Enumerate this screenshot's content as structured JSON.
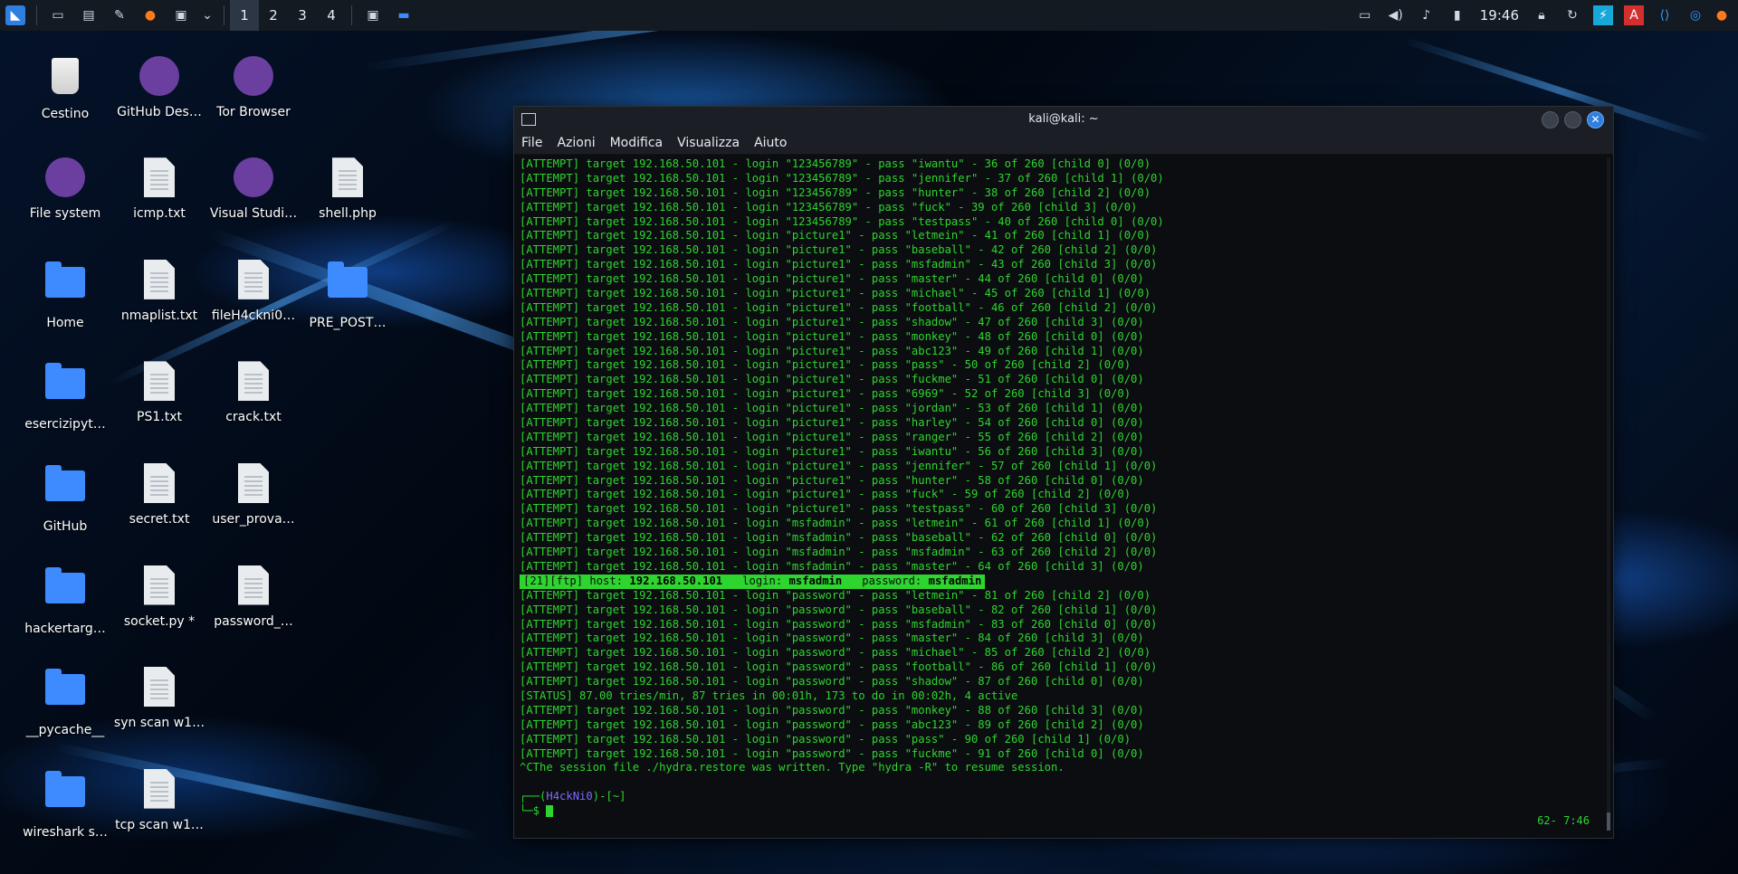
{
  "panel": {
    "workspaces": [
      "1",
      "2",
      "3",
      "4"
    ],
    "clock": "19:46"
  },
  "desktop": {
    "icons": [
      {
        "label": "Cestino",
        "kind": "bin"
      },
      {
        "label": "GitHub Des…",
        "kind": "app"
      },
      {
        "label": "Tor Browser",
        "kind": "app"
      },
      {
        "label": "File system",
        "kind": "app"
      },
      {
        "label": "icmp.txt",
        "kind": "doc"
      },
      {
        "label": "Visual Studi…",
        "kind": "app"
      },
      {
        "label": "shell.php",
        "kind": "doc"
      },
      {
        "label": "Home",
        "kind": "folder"
      },
      {
        "label": "nmaplist.txt",
        "kind": "doc"
      },
      {
        "label": "fileH4ckni0…",
        "kind": "doc"
      },
      {
        "label": "PRE_POST…",
        "kind": "folder"
      },
      {
        "label": "esercizipyt…",
        "kind": "folder"
      },
      {
        "label": "PS1.txt",
        "kind": "doc"
      },
      {
        "label": "crack.txt",
        "kind": "doc"
      },
      {
        "label": "GitHub",
        "kind": "folder"
      },
      {
        "label": "secret.txt",
        "kind": "doc"
      },
      {
        "label": "user_prova…",
        "kind": "doc"
      },
      {
        "label": "hackertarg…",
        "kind": "folder"
      },
      {
        "label": "socket.py *",
        "kind": "doc"
      },
      {
        "label": "password_…",
        "kind": "doc"
      },
      {
        "label": "__pycache__",
        "kind": "folder"
      },
      {
        "label": "syn scan w1…",
        "kind": "doc"
      },
      {
        "label": "wireshark s…",
        "kind": "folder"
      },
      {
        "label": "tcp scan w1…",
        "kind": "doc"
      }
    ]
  },
  "window": {
    "title": "kali@kali: ~",
    "menu": [
      "File",
      "Azioni",
      "Modifica",
      "Visualizza",
      "Aiuto"
    ]
  },
  "terminal": {
    "lines": [
      "[ATTEMPT] target 192.168.50.101 - login \"123456789\" - pass \"iwantu\" - 36 of 260 [child 0] (0/0)",
      "[ATTEMPT] target 192.168.50.101 - login \"123456789\" - pass \"jennifer\" - 37 of 260 [child 1] (0/0)",
      "[ATTEMPT] target 192.168.50.101 - login \"123456789\" - pass \"hunter\" - 38 of 260 [child 2] (0/0)",
      "[ATTEMPT] target 192.168.50.101 - login \"123456789\" - pass \"fuck\" - 39 of 260 [child 3] (0/0)",
      "[ATTEMPT] target 192.168.50.101 - login \"123456789\" - pass \"testpass\" - 40 of 260 [child 0] (0/0)",
      "[ATTEMPT] target 192.168.50.101 - login \"picture1\" - pass \"letmein\" - 41 of 260 [child 1] (0/0)",
      "[ATTEMPT] target 192.168.50.101 - login \"picture1\" - pass \"baseball\" - 42 of 260 [child 2] (0/0)",
      "[ATTEMPT] target 192.168.50.101 - login \"picture1\" - pass \"msfadmin\" - 43 of 260 [child 3] (0/0)",
      "[ATTEMPT] target 192.168.50.101 - login \"picture1\" - pass \"master\" - 44 of 260 [child 0] (0/0)",
      "[ATTEMPT] target 192.168.50.101 - login \"picture1\" - pass \"michael\" - 45 of 260 [child 1] (0/0)",
      "[ATTEMPT] target 192.168.50.101 - login \"picture1\" - pass \"football\" - 46 of 260 [child 2] (0/0)",
      "[ATTEMPT] target 192.168.50.101 - login \"picture1\" - pass \"shadow\" - 47 of 260 [child 3] (0/0)",
      "[ATTEMPT] target 192.168.50.101 - login \"picture1\" - pass \"monkey\" - 48 of 260 [child 0] (0/0)",
      "[ATTEMPT] target 192.168.50.101 - login \"picture1\" - pass \"abc123\" - 49 of 260 [child 1] (0/0)",
      "[ATTEMPT] target 192.168.50.101 - login \"picture1\" - pass \"pass\" - 50 of 260 [child 2] (0/0)",
      "[ATTEMPT] target 192.168.50.101 - login \"picture1\" - pass \"fuckme\" - 51 of 260 [child 0] (0/0)",
      "[ATTEMPT] target 192.168.50.101 - login \"picture1\" - pass \"6969\" - 52 of 260 [child 3] (0/0)",
      "[ATTEMPT] target 192.168.50.101 - login \"picture1\" - pass \"jordan\" - 53 of 260 [child 1] (0/0)",
      "[ATTEMPT] target 192.168.50.101 - login \"picture1\" - pass \"harley\" - 54 of 260 [child 0] (0/0)",
      "[ATTEMPT] target 192.168.50.101 - login \"picture1\" - pass \"ranger\" - 55 of 260 [child 2] (0/0)",
      "[ATTEMPT] target 192.168.50.101 - login \"picture1\" - pass \"iwantu\" - 56 of 260 [child 3] (0/0)",
      "[ATTEMPT] target 192.168.50.101 - login \"picture1\" - pass \"jennifer\" - 57 of 260 [child 1] (0/0)",
      "[ATTEMPT] target 192.168.50.101 - login \"picture1\" - pass \"hunter\" - 58 of 260 [child 0] (0/0)",
      "[ATTEMPT] target 192.168.50.101 - login \"picture1\" - pass \"fuck\" - 59 of 260 [child 2] (0/0)",
      "[ATTEMPT] target 192.168.50.101 - login \"picture1\" - pass \"testpass\" - 60 of 260 [child 3] (0/0)",
      "[ATTEMPT] target 192.168.50.101 - login \"msfadmin\" - pass \"letmein\" - 61 of 260 [child 1] (0/0)",
      "[ATTEMPT] target 192.168.50.101 - login \"msfadmin\" - pass \"baseball\" - 62 of 260 [child 0] (0/0)",
      "[ATTEMPT] target 192.168.50.101 - login \"msfadmin\" - pass \"msfadmin\" - 63 of 260 [child 2] (0/0)",
      "[ATTEMPT] target 192.168.50.101 - login \"msfadmin\" - pass \"master\" - 64 of 260 [child 3] (0/0)"
    ],
    "found": {
      "prefix": "[21][ftp] host: ",
      "host": "192.168.50.101",
      "login_label": "   login: ",
      "login": "msfadmin",
      "password_label": "   password: ",
      "password": "msfadmin"
    },
    "lines2": [
      "[ATTEMPT] target 192.168.50.101 - login \"password\" - pass \"letmein\" - 81 of 260 [child 2] (0/0)",
      "[ATTEMPT] target 192.168.50.101 - login \"password\" - pass \"baseball\" - 82 of 260 [child 1] (0/0)",
      "[ATTEMPT] target 192.168.50.101 - login \"password\" - pass \"msfadmin\" - 83 of 260 [child 0] (0/0)",
      "[ATTEMPT] target 192.168.50.101 - login \"password\" - pass \"master\" - 84 of 260 [child 3] (0/0)",
      "[ATTEMPT] target 192.168.50.101 - login \"password\" - pass \"michael\" - 85 of 260 [child 2] (0/0)",
      "[ATTEMPT] target 192.168.50.101 - login \"password\" - pass \"football\" - 86 of 260 [child 1] (0/0)",
      "[ATTEMPT] target 192.168.50.101 - login \"password\" - pass \"shadow\" - 87 of 260 [child 0] (0/0)",
      "[STATUS] 87.00 tries/min, 87 tries in 00:01h, 173 to do in 00:02h, 4 active",
      "[ATTEMPT] target 192.168.50.101 - login \"password\" - pass \"monkey\" - 88 of 260 [child 3] (0/0)",
      "[ATTEMPT] target 192.168.50.101 - login \"password\" - pass \"abc123\" - 89 of 260 [child 2] (0/0)",
      "[ATTEMPT] target 192.168.50.101 - login \"password\" - pass \"pass\" - 90 of 260 [child 1] (0/0)",
      "[ATTEMPT] target 192.168.50.101 - login \"password\" - pass \"fuckme\" - 91 of 260 [child 0] (0/0)",
      "^CThe session file ./hydra.restore was written. Type \"hydra -R\" to resume session."
    ],
    "prompt_open": "┌──(",
    "prompt_user": "H4ckNi0",
    "prompt_close": ")-[~]",
    "prompt_line2": "└─$ ",
    "corner_status": "62- 7:46"
  },
  "colors": {
    "terminal_fg": "#2fd52f",
    "terminal_bg": "#0b0d10",
    "accent": "#2f7fe0"
  }
}
